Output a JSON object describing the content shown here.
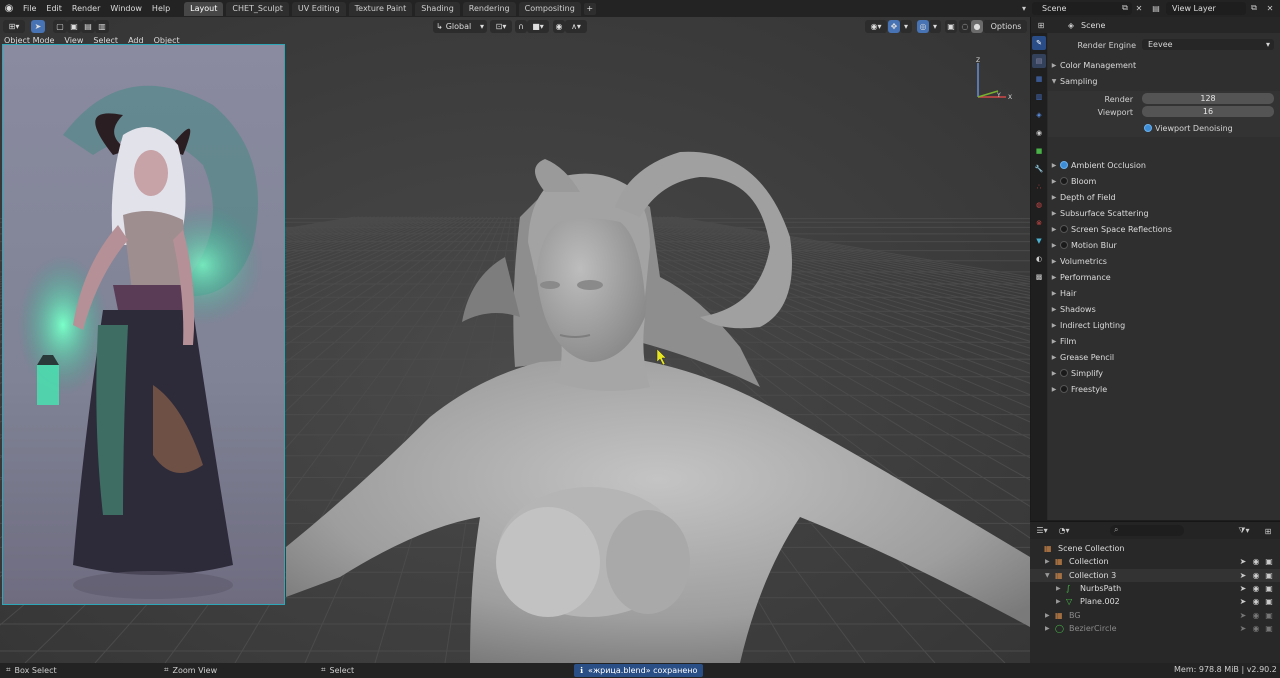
{
  "topbar": {
    "menu": [
      "File",
      "Edit",
      "Render",
      "Window",
      "Help"
    ],
    "workspaces": [
      "Layout",
      "CHET_Sculpt",
      "UV Editing",
      "Texture Paint",
      "Shading",
      "Rendering",
      "Compositing"
    ],
    "active_workspace": "Layout",
    "add_tab": "+",
    "scene": "Scene",
    "view_layer": "View Layer"
  },
  "viewport": {
    "transform_orientation": "Global",
    "options_label": "Options",
    "mode_label": "Object Mode",
    "sub_menu": [
      "View",
      "Select",
      "Add",
      "Object"
    ],
    "gizmo": {
      "x": "X",
      "y": "Y",
      "z": "Z"
    }
  },
  "properties": {
    "breadcrumb": "Scene",
    "render_engine_label": "Render Engine",
    "render_engine_value": "Eevee",
    "color_management": "Color Management",
    "sampling": "Sampling",
    "render_label": "Render",
    "render_value": "128",
    "viewport_label": "Viewport",
    "viewport_value": "16",
    "viewport_denoising": "Viewport Denoising",
    "panels": [
      {
        "label": "Ambient Occlusion",
        "toggle": "on"
      },
      {
        "label": "Bloom",
        "toggle": "off"
      },
      {
        "label": "Depth of Field",
        "toggle": "none"
      },
      {
        "label": "Subsurface Scattering",
        "toggle": "none"
      },
      {
        "label": "Screen Space Reflections",
        "toggle": "off"
      },
      {
        "label": "Motion Blur",
        "toggle": "off"
      },
      {
        "label": "Volumetrics",
        "toggle": "none"
      },
      {
        "label": "Performance",
        "toggle": "none"
      },
      {
        "label": "Hair",
        "toggle": "none"
      },
      {
        "label": "Shadows",
        "toggle": "none"
      },
      {
        "label": "Indirect Lighting",
        "toggle": "none"
      },
      {
        "label": "Film",
        "toggle": "none"
      },
      {
        "label": "Grease Pencil",
        "toggle": "none"
      },
      {
        "label": "Simplify",
        "toggle": "off"
      },
      {
        "label": "Freestyle",
        "toggle": "off"
      }
    ]
  },
  "outliner": {
    "rows": [
      {
        "label": "Scene Collection",
        "indent": 0,
        "dim": false
      },
      {
        "label": "Collection",
        "indent": 1,
        "dim": false
      },
      {
        "label": "Collection 3",
        "indent": 1,
        "dim": false
      },
      {
        "label": "NurbsPath",
        "indent": 2,
        "dim": false
      },
      {
        "label": "Plane.002",
        "indent": 2,
        "dim": false
      },
      {
        "label": "BG",
        "indent": 1,
        "dim": true
      },
      {
        "label": "BezierCircle",
        "indent": 1,
        "dim": true
      }
    ]
  },
  "status": {
    "box_select": "Box Select",
    "zoom_view": "Zoom View",
    "select": "Select",
    "notification": "«жрица.blend» сохранено",
    "mem": "Mem: 978.8 MiB | v2.90.2"
  }
}
